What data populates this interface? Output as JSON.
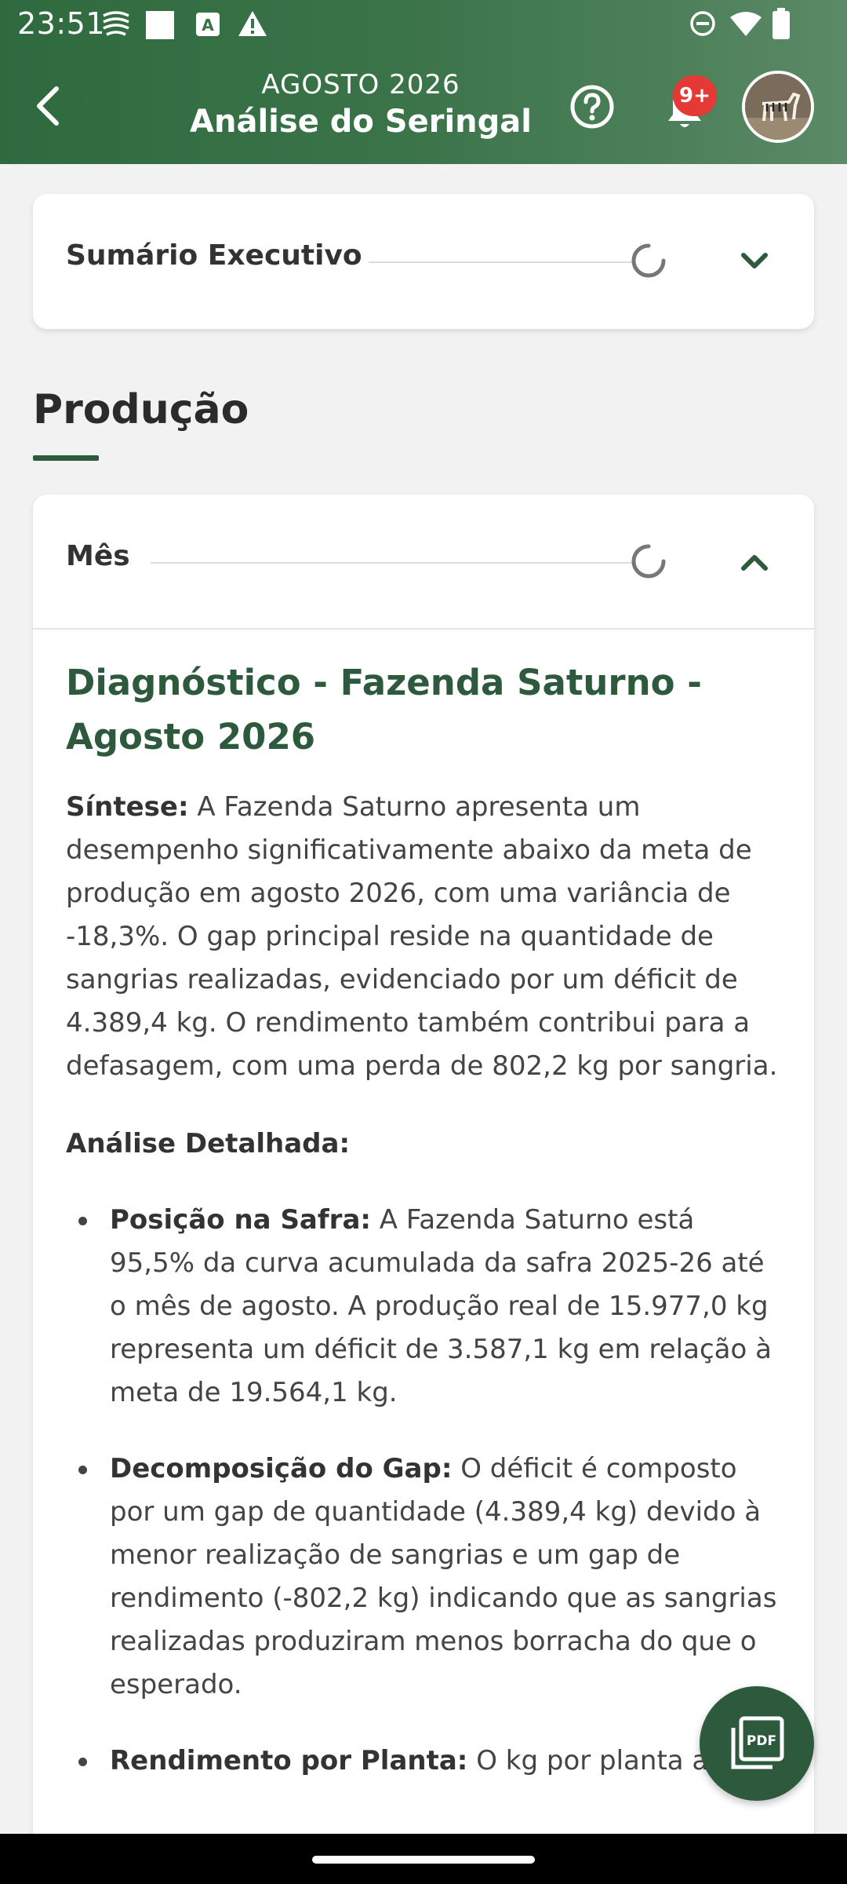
{
  "status_bar": {
    "time": "23:51",
    "icons": [
      "wifi-calling-icon",
      "square-icon",
      "font-a-icon",
      "warning-icon",
      "do-not-disturb-icon",
      "wifi-icon",
      "battery-icon"
    ]
  },
  "header": {
    "subtitle": "AGOSTO 2026",
    "title": "Análise do Seringal",
    "notification_badge": "9+",
    "colors": {
      "header_bg": "#3a7348",
      "accent": "#2d5a3d",
      "badge": "#e53935"
    }
  },
  "executive_summary": {
    "label": "Sumário Executivo",
    "expanded": false
  },
  "section": {
    "title": "Produção"
  },
  "month_card": {
    "label": "Mês",
    "expanded": true,
    "diagnostic_title": "Diagnóstico - Fazenda Saturno - Agosto 2026",
    "synthesis_label": "Síntese:",
    "synthesis_text": " A Fazenda Saturno apresenta um desempenho significativamente abaixo da meta de produção em agosto 2026, com uma variância de -18,3%. O gap principal reside na quantidade de sangrias realizadas, evidenciado por um déficit de 4.389,4 kg. O rendimento também contribui para a defasagem, com uma perda de 802,2 kg por sangria.",
    "detailed_label": "Análise Detalhada:",
    "bullets": [
      {
        "label": "Posição na Safra:",
        "text": " A Fazenda Saturno está 95,5% da curva acumulada da safra 2025-26 até o mês de agosto.  A produção real de 15.977,0 kg representa um déficit de 3.587,1 kg em relação à meta de 19.564,1 kg."
      },
      {
        "label": "Decomposição do Gap:",
        "text": " O déficit é composto por um gap de quantidade (4.389,4 kg) devido à menor realização de sangrias e um gap de rendimento (-802,2 kg)  indicando que as sangrias realizadas produziram menos borracha do que o esperado."
      },
      {
        "label": "Rendimento por Planta:",
        "text": " O kg por planta apta"
      }
    ]
  },
  "fab": {
    "label": "PDF"
  }
}
